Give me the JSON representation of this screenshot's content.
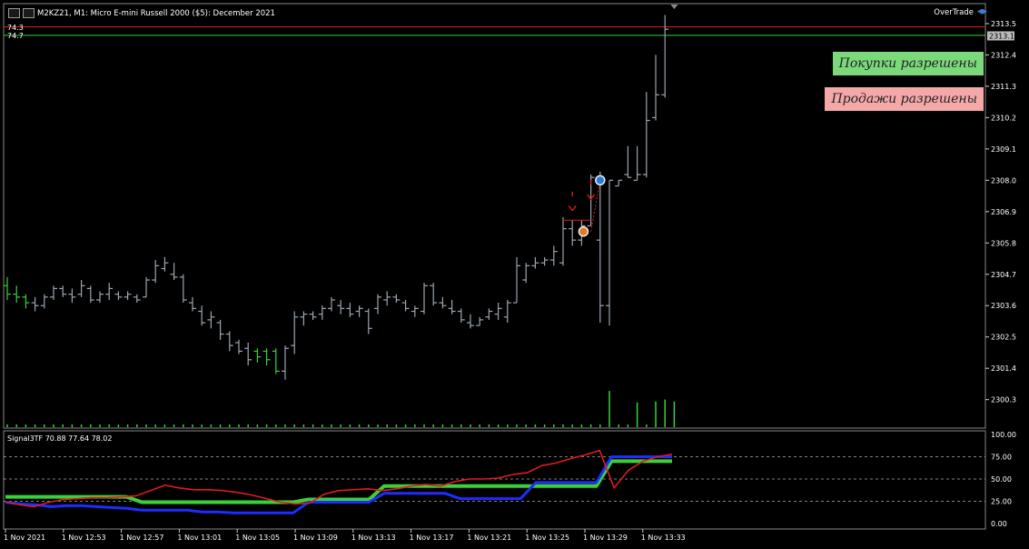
{
  "header": {
    "title": "M2KZ21, M1:  Micro E-mini Russell 2000 ($5): December 2021"
  },
  "overtrade": {
    "label": "OverTrade"
  },
  "badges": {
    "buy": "Покупки разрешены",
    "sell": "Продажи разрешены"
  },
  "levels": {
    "upper": "74.3",
    "lower": "74.7"
  },
  "indicator": {
    "title": "Signal3TF 70.88 77.64 78.02"
  },
  "colors": {
    "bar": "#9aa5b1",
    "green": "#3bd03b",
    "red": "#e01b1b",
    "blue": "#1d2cff",
    "grid": "#ffffff"
  },
  "chart_data": {
    "type": "ohlc",
    "price_axis": {
      "ticks": [
        "2313.5",
        "2312.4",
        "2311.3",
        "2310.2",
        "2309.1",
        "2308.0",
        "2306.9",
        "2305.8",
        "2304.7",
        "2303.6",
        "2302.5",
        "2301.4",
        "2300.3"
      ],
      "current_price": "2313.1",
      "ylim": [
        2299.3,
        2314.2
      ]
    },
    "time_axis": {
      "ticks": [
        "1 Nov 2021",
        "1 Nov 12:53",
        "1 Nov 12:57",
        "1 Nov 13:01",
        "1 Nov 13:05",
        "1 Nov 13:09",
        "1 Nov 13:13",
        "1 Nov 13:17",
        "1 Nov 13:21",
        "1 Nov 13:25",
        "1 Nov 13:29",
        "1 Nov 13:33"
      ]
    },
    "bars": [
      [
        2304.3,
        2304.6,
        2303.8,
        2304.0
      ],
      [
        2304.0,
        2304.3,
        2303.7,
        2303.9
      ],
      [
        2303.9,
        2304.0,
        2303.5,
        2303.7
      ],
      [
        2303.7,
        2303.9,
        2303.4,
        2303.6
      ],
      [
        2303.6,
        2304.0,
        2303.5,
        2303.9
      ],
      [
        2303.9,
        2304.3,
        2303.8,
        2304.2
      ],
      [
        2304.2,
        2304.3,
        2303.9,
        2304.0
      ],
      [
        2304.0,
        2304.2,
        2303.7,
        2303.9
      ],
      [
        2304.0,
        2304.5,
        2303.9,
        2304.3
      ],
      [
        2304.2,
        2304.3,
        2303.7,
        2303.8
      ],
      [
        2303.8,
        2304.1,
        2303.7,
        2304.0
      ],
      [
        2304.0,
        2304.4,
        2303.8,
        2304.2
      ],
      [
        2304.0,
        2304.1,
        2303.8,
        2303.9
      ],
      [
        2303.9,
        2304.1,
        2303.8,
        2304.0
      ],
      [
        2303.9,
        2304.0,
        2303.7,
        2303.8
      ],
      [
        2303.9,
        2304.6,
        2303.9,
        2304.5
      ],
      [
        2304.5,
        2305.2,
        2304.4,
        2305.0
      ],
      [
        2304.9,
        2305.3,
        2304.8,
        2305.1
      ],
      [
        2304.7,
        2305.1,
        2304.5,
        2304.6
      ],
      [
        2304.6,
        2304.7,
        2303.7,
        2303.8
      ],
      [
        2303.7,
        2303.9,
        2303.4,
        2303.5
      ],
      [
        2303.4,
        2303.6,
        2302.9,
        2303.0
      ],
      [
        2303.1,
        2303.4,
        2302.8,
        2303.2
      ],
      [
        2303.0,
        2303.1,
        2302.4,
        2302.6
      ],
      [
        2302.6,
        2302.7,
        2302.0,
        2302.2
      ],
      [
        2302.3,
        2302.4,
        2301.9,
        2302.0
      ],
      [
        2302.1,
        2302.3,
        2301.5,
        2301.7
      ],
      [
        2302.0,
        2302.1,
        2301.6,
        2301.8
      ],
      [
        2302.0,
        2302.1,
        2301.5,
        2301.7
      ],
      [
        2302.0,
        2302.1,
        2301.2,
        2301.3
      ],
      [
        2301.3,
        2302.2,
        2301.0,
        2302.1
      ],
      [
        2302.2,
        2303.4,
        2301.9,
        2303.2
      ],
      [
        2303.2,
        2303.4,
        2302.9,
        2303.3
      ],
      [
        2303.3,
        2303.4,
        2303.1,
        2303.2
      ],
      [
        2303.3,
        2303.6,
        2303.1,
        2303.5
      ],
      [
        2303.5,
        2303.9,
        2303.4,
        2303.8
      ],
      [
        2303.6,
        2303.8,
        2303.3,
        2303.5
      ],
      [
        2303.5,
        2303.7,
        2303.2,
        2303.3
      ],
      [
        2303.4,
        2303.6,
        2303.2,
        2303.5
      ],
      [
        2303.4,
        2303.5,
        2302.6,
        2302.8
      ],
      [
        2303.5,
        2304.0,
        2303.3,
        2303.9
      ],
      [
        2303.8,
        2304.1,
        2303.6,
        2303.9
      ],
      [
        2303.9,
        2304.0,
        2303.7,
        2303.8
      ],
      [
        2303.7,
        2303.8,
        2303.4,
        2303.5
      ],
      [
        2303.4,
        2303.6,
        2303.2,
        2303.5
      ],
      [
        2303.4,
        2304.4,
        2303.3,
        2304.3
      ],
      [
        2304.3,
        2304.4,
        2303.6,
        2303.7
      ],
      [
        2303.7,
        2303.9,
        2303.5,
        2303.6
      ],
      [
        2303.5,
        2303.8,
        2303.3,
        2303.4
      ],
      [
        2303.4,
        2303.5,
        2303.0,
        2303.1
      ],
      [
        2303.0,
        2303.3,
        2302.8,
        2302.9
      ],
      [
        2302.9,
        2303.2,
        2302.9,
        2303.1
      ],
      [
        2303.2,
        2303.5,
        2303.1,
        2303.4
      ],
      [
        2303.3,
        2303.7,
        2303.1,
        2303.5
      ],
      [
        2303.2,
        2303.8,
        2303.0,
        2303.7
      ],
      [
        2303.7,
        2305.3,
        2303.7,
        2305.0
      ],
      [
        2304.5,
        2305.1,
        2304.4,
        2305.0
      ],
      [
        2305.0,
        2305.3,
        2304.9,
        2305.1
      ],
      [
        2305.1,
        2305.3,
        2305.0,
        2305.2
      ],
      [
        2305.2,
        2305.7,
        2305.0,
        2305.5
      ],
      [
        2305.1,
        2306.7,
        2305.0,
        2306.3
      ],
      [
        2306.3,
        2306.6,
        2305.7,
        2305.9
      ],
      [
        2305.9,
        2306.6,
        2305.7,
        2306.4
      ],
      [
        2306.4,
        2308.2,
        2306.4,
        2308.1
      ],
      [
        2305.9,
        2308.3,
        2303.0,
        2303.6
      ],
      [
        2303.6,
        2308.0,
        2302.9,
        2308.0
      ],
      [
        2307.8,
        2308.0,
        2307.8,
        2308.0
      ],
      [
        2308.2,
        2309.2,
        2308.1,
        2308.1
      ],
      [
        2308.0,
        2309.2,
        2308.0,
        2308.2
      ],
      [
        2308.2,
        2311.1,
        2308.1,
        2310.1
      ],
      [
        2310.2,
        2312.4,
        2310.1,
        2311.0
      ],
      [
        2311.0,
        2313.8,
        2310.9,
        2313.3
      ]
    ],
    "volumes": [
      0,
      0,
      0,
      0,
      0,
      0,
      0,
      0,
      0,
      0,
      0,
      0,
      0,
      0,
      0,
      0,
      0,
      0,
      0,
      0,
      0,
      0,
      0,
      0,
      0,
      0,
      0,
      0,
      0,
      0,
      0,
      0,
      0,
      0,
      0,
      0,
      0,
      0,
      0,
      0,
      0,
      0,
      0,
      0,
      0,
      0,
      0,
      0,
      0,
      0,
      0,
      0,
      0,
      0,
      0,
      0,
      0,
      0,
      0,
      0,
      0,
      0,
      0,
      0,
      0,
      38,
      0,
      0,
      26,
      0,
      27,
      29,
      27
    ],
    "indicator_axis": {
      "ticks": [
        "100.00",
        "75.00",
        "50.00",
        "25.00",
        "0.00"
      ],
      "ylim": [
        0,
        100
      ]
    },
    "series": [
      {
        "color": "red",
        "values": [
          24,
          21,
          19,
          24,
          27,
          28,
          29,
          29,
          30,
          31,
          37,
          43,
          40,
          38,
          38,
          37,
          35,
          32,
          28,
          24,
          22,
          23,
          33,
          37,
          38,
          39,
          37,
          39,
          42,
          44,
          42,
          47,
          50,
          50,
          51,
          55,
          57,
          65,
          68,
          73,
          77,
          82,
          40,
          60,
          70,
          75,
          78
        ]
      },
      {
        "color": "blue",
        "values": [
          24,
          22,
          21,
          19,
          20,
          20,
          19,
          18,
          17,
          15,
          15,
          15,
          15,
          13,
          13,
          12,
          12,
          12,
          12,
          12,
          24,
          24,
          24,
          24,
          24,
          34,
          34,
          34,
          34,
          34,
          28,
          28,
          28,
          28,
          28,
          46,
          46,
          46,
          46,
          46,
          75,
          75,
          75,
          75,
          75
        ]
      },
      {
        "color": "green",
        "values": [
          30,
          30,
          30,
          30,
          30,
          30,
          30,
          30,
          30,
          24,
          24,
          24,
          24,
          24,
          24,
          24,
          24,
          24,
          24,
          24,
          27,
          27,
          27,
          27,
          27,
          42,
          42,
          42,
          42,
          42,
          42,
          42,
          42,
          42,
          42,
          42,
          42,
          42,
          42,
          42,
          70,
          70,
          70,
          70,
          70
        ]
      }
    ]
  }
}
